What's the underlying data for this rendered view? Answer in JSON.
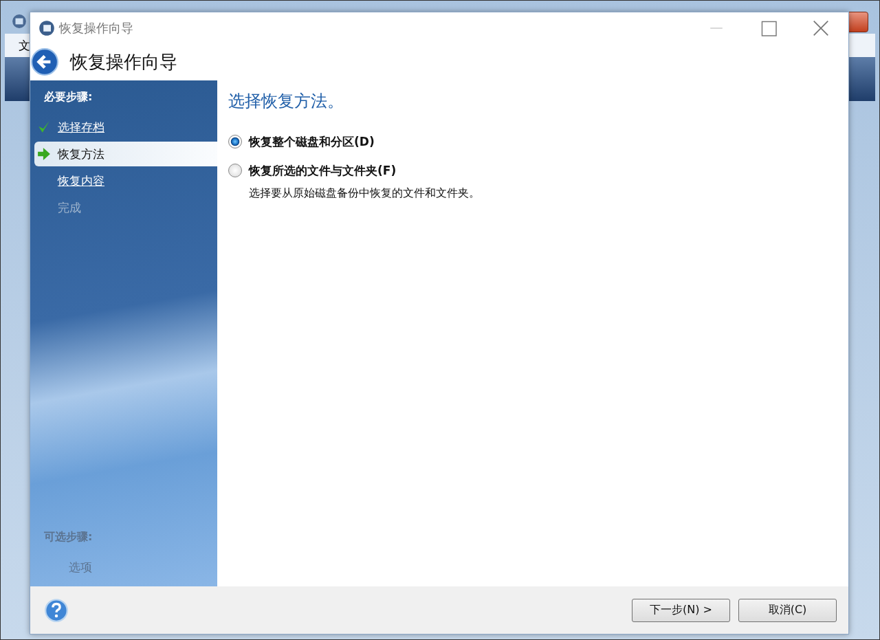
{
  "background_window": {
    "menu_item": "文"
  },
  "window": {
    "title": "恢复操作向导"
  },
  "header": {
    "title": "恢复操作向导"
  },
  "sidebar": {
    "required_heading": "必要步骤:",
    "steps": [
      {
        "label": "选择存档",
        "kind": "done",
        "selected": false
      },
      {
        "label": "恢复方法",
        "kind": "current",
        "selected": true
      },
      {
        "label": "恢复内容",
        "kind": "pending",
        "selected": false
      },
      {
        "label": "完成",
        "kind": "disabled",
        "selected": false
      }
    ],
    "optional_heading": "可选步骤:",
    "optional_steps": [
      {
        "label": "选项",
        "disabled": true
      }
    ]
  },
  "content": {
    "heading": "选择恢复方法。",
    "options": [
      {
        "label": "恢复整个磁盘和分区(**D**)",
        "selected": true
      },
      {
        "label": "恢复所选的文件与文件夹(**F**)",
        "selected": false,
        "description": "选择要从原始磁盘备份中恢复的文件和文件夹。"
      }
    ]
  },
  "footer": {
    "buttons": [
      "下一步(N) >",
      "取消(C)"
    ]
  }
}
